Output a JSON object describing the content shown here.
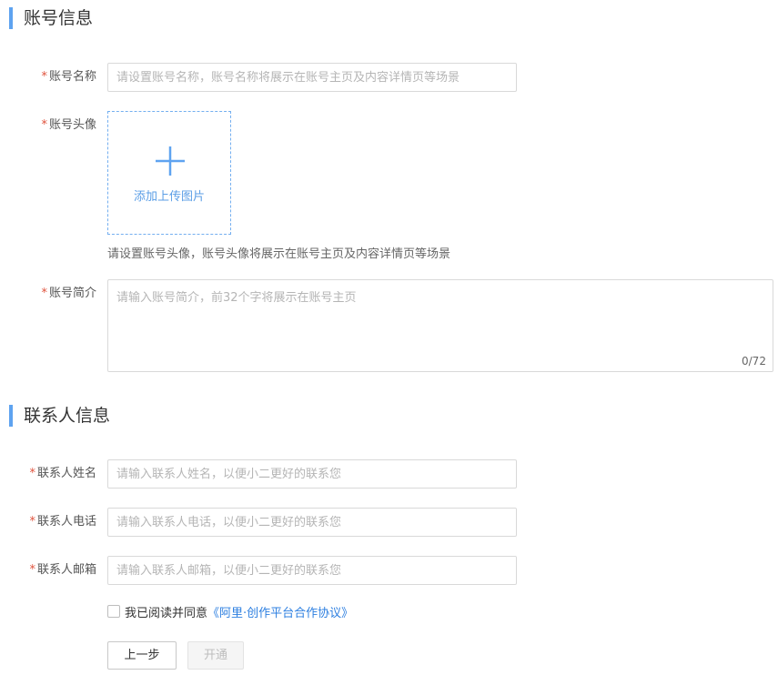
{
  "account_section": {
    "title": "账号信息",
    "name_label": "账号名称",
    "name_placeholder": "请设置账号名称，账号名称将展示在账号主页及内容详情页等场景",
    "avatar_label": "账号头像",
    "upload_text": "添加上传图片",
    "avatar_hint": "请设置账号头像，账号头像将展示在账号主页及内容详情页等场景",
    "intro_label": "账号简介",
    "intro_placeholder": "请输入账号简介，前32个字将展示在账号主页",
    "intro_counter": "0/72"
  },
  "contact_section": {
    "title": "联系人信息",
    "name_label": "联系人姓名",
    "name_placeholder": "请输入联系人姓名，以便小二更好的联系您",
    "phone_label": "联系人电话",
    "phone_placeholder": "请输入联系人电话，以便小二更好的联系您",
    "email_label": "联系人邮箱",
    "email_placeholder": "请输入联系人邮箱，以便小二更好的联系您"
  },
  "agreement": {
    "text": "我已阅读并同意",
    "link": "《阿里·创作平台合作协议》",
    "checked": false
  },
  "buttons": {
    "prev": "上一步",
    "open": "开通"
  },
  "required_mark": "*",
  "icons": {
    "upload": "plus-icon"
  },
  "colors": {
    "accent": "#5ea3f0",
    "link": "#2d7fe0",
    "required": "#e0533d"
  }
}
